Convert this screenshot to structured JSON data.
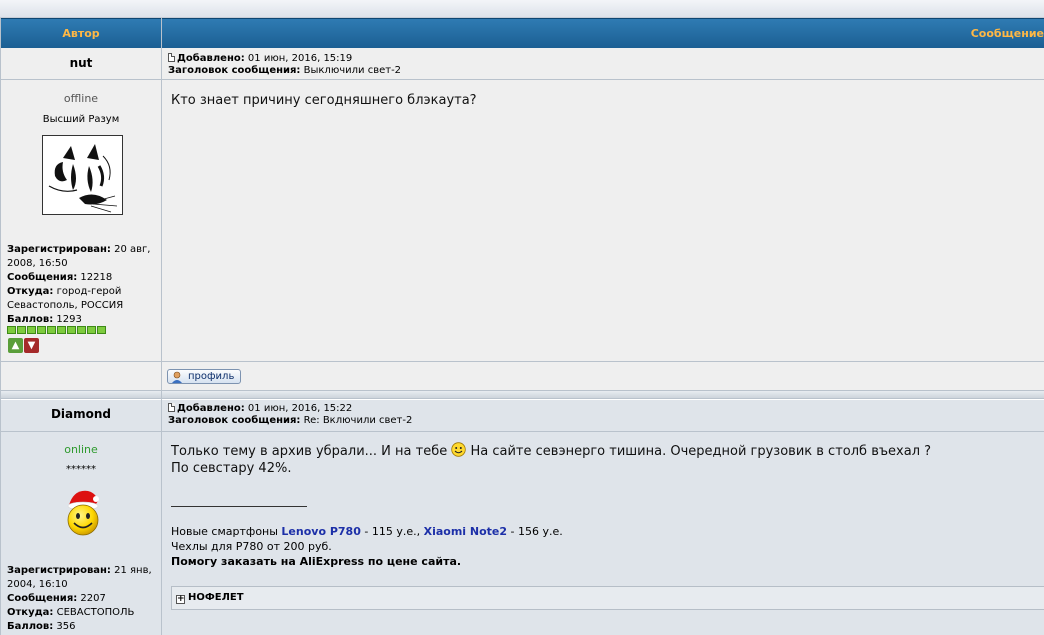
{
  "header": {
    "author": "Автор",
    "message": "Сообщение"
  },
  "labels": {
    "added": "Добавлено:",
    "subject": "Заголовок сообщения:",
    "registered": "Зарегистрирован:",
    "messages": "Сообщения:",
    "from": "Откуда:",
    "points": "Баллов:",
    "profile_btn": "профиль"
  },
  "posts": [
    {
      "username": "nut",
      "date": "01 июн, 2016, 15:19",
      "subject": "Выключили свет-2",
      "status": "offline",
      "rank": "Высший Разум",
      "registered": "20 авг, 2008, 16:50",
      "messages": "12218",
      "from": "город-герой Севастополь, РОССИЯ",
      "points": "1293",
      "text": "Кто знает причину сегодняшнего блэкаута?"
    },
    {
      "username": "Diamond",
      "date": "01 июн, 2016, 15:22",
      "subject": "Re: Включили свет-2",
      "status": "online",
      "rank": "******",
      "registered": "21 янв, 2004, 16:10",
      "messages": "2207",
      "from": "СЕВАСТОПОЛЬ",
      "points": "356",
      "text_a": "Только тему в архив убрали... И на тебе",
      "text_b": "На сайте севэнерго тишина. Очередной грузовик в столб въехал ?",
      "text_c": "По севстару 42%.",
      "sig": {
        "l1_pre": "Новые смартфоны ",
        "l1_link1": "Lenovo P780",
        "l1_mid": " - 115 у.е., ",
        "l1_link2": "Xiaomi Note2",
        "l1_post": " - 156 у.е.",
        "l2": "Чехлы для P780 от 200 руб.",
        "l3": "Помогу заказать на AliExpress по цене сайта."
      },
      "spoiler": "НОФЕЛЕТ"
    }
  ],
  "colors": {
    "header_bg": "#1b5f93",
    "header_text": "#ffb845",
    "link": "#1c2fa8",
    "online": "#2e9a2e"
  }
}
